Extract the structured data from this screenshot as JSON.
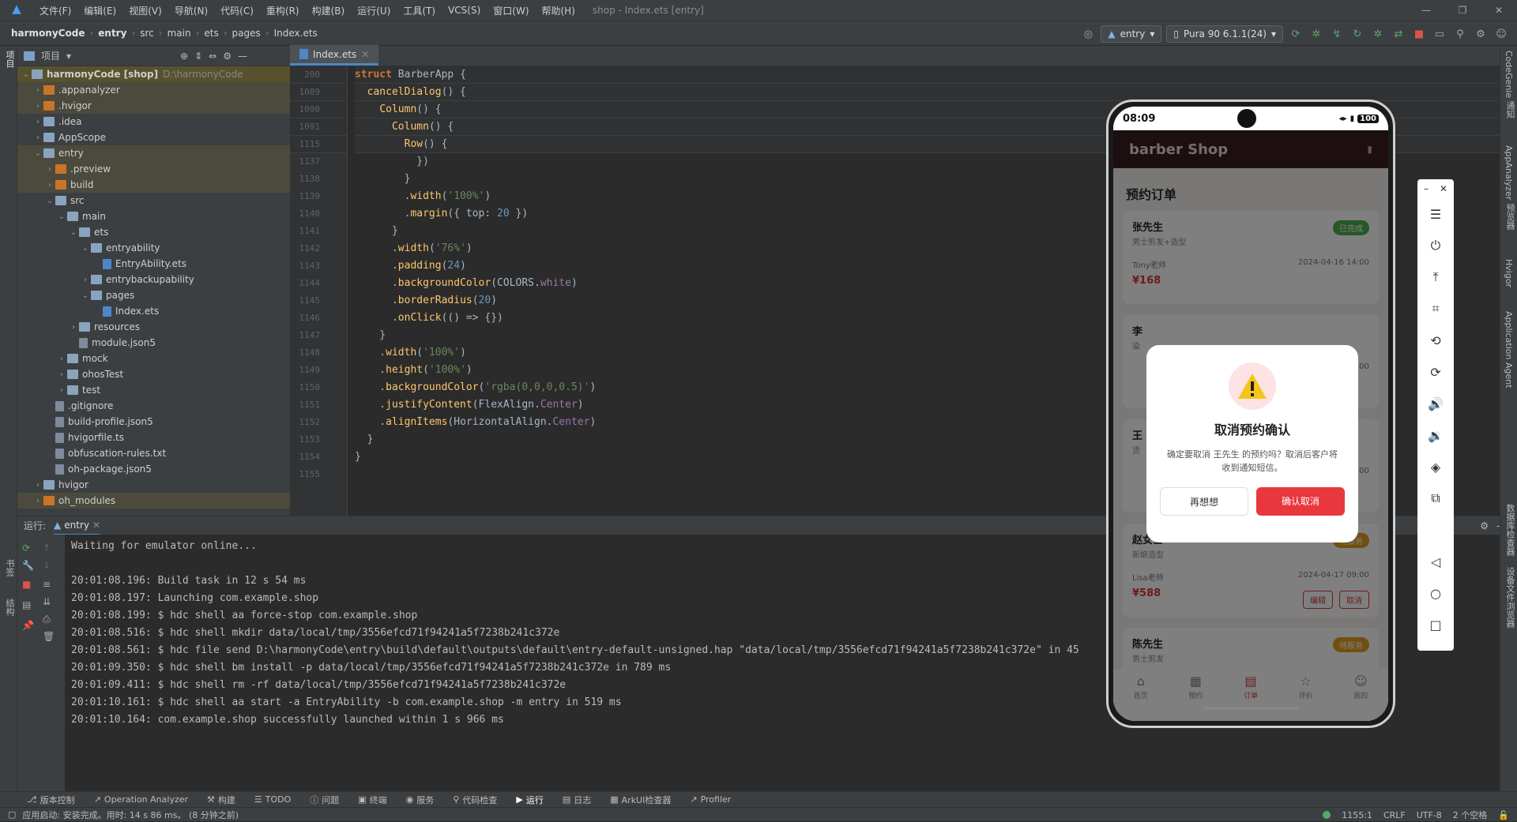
{
  "menubar": {
    "items": [
      "文件(F)",
      "编辑(E)",
      "视图(V)",
      "导航(N)",
      "代码(C)",
      "重构(R)",
      "构建(B)",
      "运行(U)",
      "工具(T)",
      "VCS(S)",
      "窗口(W)",
      "帮助(H)"
    ],
    "title": "shop - Index.ets [entry]"
  },
  "navbar": {
    "crumbs": [
      "harmonyCode",
      "entry",
      "src",
      "main",
      "ets",
      "pages",
      "Index.ets"
    ],
    "config": "entry",
    "device": "Pura 90 6.1.1(24)"
  },
  "leftstrip": {
    "project": "项目",
    "bookmarks": "书签",
    "structure": "结构"
  },
  "project": {
    "header": "项目",
    "tree": [
      {
        "label": "harmonyCode [shop]",
        "hint": "D:\\harmonyCode",
        "depth": 0,
        "arrow": "v",
        "kind": "dir"
      },
      {
        "label": ".appanalyzer",
        "depth": 1,
        "arrow": ">",
        "kind": "dir-o"
      },
      {
        "label": ".hvigor",
        "depth": 1,
        "arrow": ">",
        "kind": "dir-o"
      },
      {
        "label": ".idea",
        "depth": 1,
        "arrow": ">",
        "kind": "dir"
      },
      {
        "label": "AppScope",
        "depth": 1,
        "arrow": ">",
        "kind": "dir"
      },
      {
        "label": "entry",
        "depth": 1,
        "arrow": "v",
        "kind": "dir"
      },
      {
        "label": ".preview",
        "depth": 2,
        "arrow": ">",
        "kind": "dir-o"
      },
      {
        "label": "build",
        "depth": 2,
        "arrow": ">",
        "kind": "dir-o"
      },
      {
        "label": "src",
        "depth": 2,
        "arrow": "v",
        "kind": "dir"
      },
      {
        "label": "main",
        "depth": 3,
        "arrow": "v",
        "kind": "dir"
      },
      {
        "label": "ets",
        "depth": 4,
        "arrow": "v",
        "kind": "dir"
      },
      {
        "label": "entryability",
        "depth": 5,
        "arrow": "v",
        "kind": "dir"
      },
      {
        "label": "EntryAbility.ets",
        "depth": 6,
        "arrow": "",
        "kind": "ets"
      },
      {
        "label": "entrybackupability",
        "depth": 5,
        "arrow": ">",
        "kind": "dir"
      },
      {
        "label": "pages",
        "depth": 5,
        "arrow": "v",
        "kind": "dir"
      },
      {
        "label": "Index.ets",
        "depth": 6,
        "arrow": "",
        "kind": "ets"
      },
      {
        "label": "resources",
        "depth": 4,
        "arrow": ">",
        "kind": "dir"
      },
      {
        "label": "module.json5",
        "depth": 4,
        "arrow": "",
        "kind": "file"
      },
      {
        "label": "mock",
        "depth": 3,
        "arrow": ">",
        "kind": "dir"
      },
      {
        "label": "ohosTest",
        "depth": 3,
        "arrow": ">",
        "kind": "dir"
      },
      {
        "label": "test",
        "depth": 3,
        "arrow": ">",
        "kind": "dir"
      },
      {
        "label": ".gitignore",
        "depth": 2,
        "arrow": "",
        "kind": "file"
      },
      {
        "label": "build-profile.json5",
        "depth": 2,
        "arrow": "",
        "kind": "file"
      },
      {
        "label": "hvigorfile.ts",
        "depth": 2,
        "arrow": "",
        "kind": "file"
      },
      {
        "label": "obfuscation-rules.txt",
        "depth": 2,
        "arrow": "",
        "kind": "file"
      },
      {
        "label": "oh-package.json5",
        "depth": 2,
        "arrow": "",
        "kind": "file"
      },
      {
        "label": "hvigor",
        "depth": 1,
        "arrow": ">",
        "kind": "dir"
      },
      {
        "label": "oh_modules",
        "depth": 1,
        "arrow": ">",
        "kind": "dir-o"
      }
    ]
  },
  "editor": {
    "tab": "Index.ets",
    "sticky": [
      {
        "ln": "200",
        "html": "<span class=\"kw\">struct</span> <span class=\"ty\">BarberApp</span> {"
      },
      {
        "ln": "1089",
        "html": "  <span class=\"fn\">cancelDialog</span>() {"
      },
      {
        "ln": "1090",
        "html": "    <span class=\"fn\">Column</span>() {"
      },
      {
        "ln": "1091",
        "html": "      <span class=\"fn\">Column</span>() {"
      },
      {
        "ln": "1115",
        "html": "        <span class=\"fn\">Row</span>() {"
      }
    ],
    "lines": [
      {
        "ln": "1137",
        "html": "          })"
      },
      {
        "ln": "1138",
        "html": "        }"
      },
      {
        "ln": "1139",
        "html": "        .<span class=\"fn\">width</span>(<span class=\"str\">'100%'</span>)"
      },
      {
        "ln": "1140",
        "html": "        .<span class=\"fn\">margin</span>({ <span class=\"ty\">top</span>: <span class=\"num\">20</span> })"
      },
      {
        "ln": "1141",
        "html": "      }"
      },
      {
        "ln": "1142",
        "html": "      .<span class=\"fn\">width</span>(<span class=\"str\">'76%'</span>)"
      },
      {
        "ln": "1143",
        "html": "      .<span class=\"fn\">padding</span>(<span class=\"num\">24</span>)"
      },
      {
        "ln": "1144",
        "html": "      .<span class=\"fn\">backgroundColor</span>(<span class=\"ty\">COLORS</span>.<span class=\"pr\">white</span>)"
      },
      {
        "ln": "1145",
        "html": "      .<span class=\"fn\">borderRadius</span>(<span class=\"num\">20</span>)"
      },
      {
        "ln": "1146",
        "html": "      .<span class=\"fn\">onClick</span>(() => {})"
      },
      {
        "ln": "1147",
        "html": "    }"
      },
      {
        "ln": "1148",
        "html": "    .<span class=\"fn\">width</span>(<span class=\"str\">'100%'</span>)"
      },
      {
        "ln": "1149",
        "html": "    .<span class=\"fn\">height</span>(<span class=\"str\">'100%'</span>)"
      },
      {
        "ln": "1150",
        "html": "    .<span class=\"fn\">backgroundColor</span>(<span class=\"str\">'rgba(0,0,0,0.5)'</span>)"
      },
      {
        "ln": "1151",
        "html": "    .<span class=\"fn\">justifyContent</span>(<span class=\"ty\">FlexAlign</span>.<span class=\"pr\">Center</span>)"
      },
      {
        "ln": "1152",
        "html": "    .<span class=\"fn\">alignItems</span>(<span class=\"ty\">HorizontalAlign</span>.<span class=\"pr\">Center</span>)"
      },
      {
        "ln": "1153",
        "html": "  }"
      },
      {
        "ln": "1154",
        "html": "}"
      },
      {
        "ln": "1155",
        "html": ""
      }
    ]
  },
  "run": {
    "label": "运行:",
    "tab": "entry",
    "console": [
      "Waiting for emulator online...",
      "",
      "20:01:08.196: Build task in 12 s 54 ms",
      "20:01:08.197: Launching com.example.shop",
      "20:01:08.199: $ hdc shell aa force-stop com.example.shop",
      "20:01:08.516: $ hdc shell mkdir data/local/tmp/3556efcd71f94241a5f7238b241c372e",
      "20:01:08.561: $ hdc file send D:\\harmonyCode\\entry\\build\\default\\outputs\\default\\entry-default-unsigned.hap \"data/local/tmp/3556efcd71f94241a5f7238b241c372e\" in 45",
      "20:01:09.350: $ hdc shell bm install -p data/local/tmp/3556efcd71f94241a5f7238b241c372e in 789 ms",
      "20:01:09.411: $ hdc shell rm -rf data/local/tmp/3556efcd71f94241a5f7238b241c372e",
      "20:01:10.161: $ hdc shell aa start -a EntryAbility -b com.example.shop -m entry in 519 ms",
      "20:01:10.164: com.example.shop successfully launched within 1 s 966 ms"
    ]
  },
  "bottombar": [
    "版本控制",
    "Operation Analyzer",
    "构建",
    "TODO",
    "问题",
    "终端",
    "服务",
    "代码检查",
    "运行",
    "日志",
    "ArkUI检查器",
    "Profiler"
  ],
  "statusbar": {
    "message": "应用启动: 安装完成。用时: 14 s 86 ms。 (8 分钟之前)",
    "position": "1155:1",
    "lineSep": "CRLF",
    "encoding": "UTF-8",
    "indent": "2 个空格"
  },
  "rightstrip": [
    "CodeGenie",
    "通知",
    "AppAnalyzer",
    "预览器",
    "Hvigor",
    "Application Agent",
    "数据库检查器",
    "设备文件浏览器"
  ],
  "phone": {
    "time": "08:09",
    "battery": "100",
    "appTitle": "barber Shop",
    "sectionTitle": "预约订单",
    "orders": [
      {
        "name": "张先生",
        "service": "男士剪发+造型",
        "stylist": "Tony老师",
        "datetime": "2024-04-16 14:00",
        "price": "¥168",
        "status": "已完成",
        "statusColor": "#4caf50",
        "actions": []
      },
      {
        "name": "李",
        "service": "染",
        "stylist": "",
        "datetime": "00",
        "price": "",
        "status": "",
        "statusColor": "#d8373a",
        "actions": []
      },
      {
        "name": "王",
        "service": "烫",
        "stylist": "",
        "datetime": "00",
        "price": "",
        "status": "",
        "statusColor": "#e0a020",
        "actions": []
      },
      {
        "name": "赵女士",
        "service": "新娘造型",
        "stylist": "Lisa老师",
        "datetime": "2024-04-17 09:00",
        "price": "¥588",
        "status": "待服务",
        "statusColor": "#e0a020",
        "actions": [
          "编辑",
          "取消"
        ]
      },
      {
        "name": "陈先生",
        "service": "男士剪发",
        "stylist": "",
        "datetime": "",
        "price": "",
        "status": "待服务",
        "statusColor": "#e0a020",
        "actions": []
      }
    ],
    "dialog": {
      "title": "取消预约确认",
      "message": "确定要取消 王先生 的预约吗？取消后客户将收到通知短信。",
      "cancel": "再想想",
      "confirm": "确认取消"
    },
    "tabs": [
      {
        "label": "首页",
        "icon": "home-icon",
        "active": false
      },
      {
        "label": "预约",
        "icon": "calendar-icon",
        "active": false
      },
      {
        "label": "订单",
        "icon": "clipboard-icon",
        "active": true
      },
      {
        "label": "评价",
        "icon": "star-icon",
        "active": false
      },
      {
        "label": "我的",
        "icon": "user-icon",
        "active": false
      }
    ]
  }
}
